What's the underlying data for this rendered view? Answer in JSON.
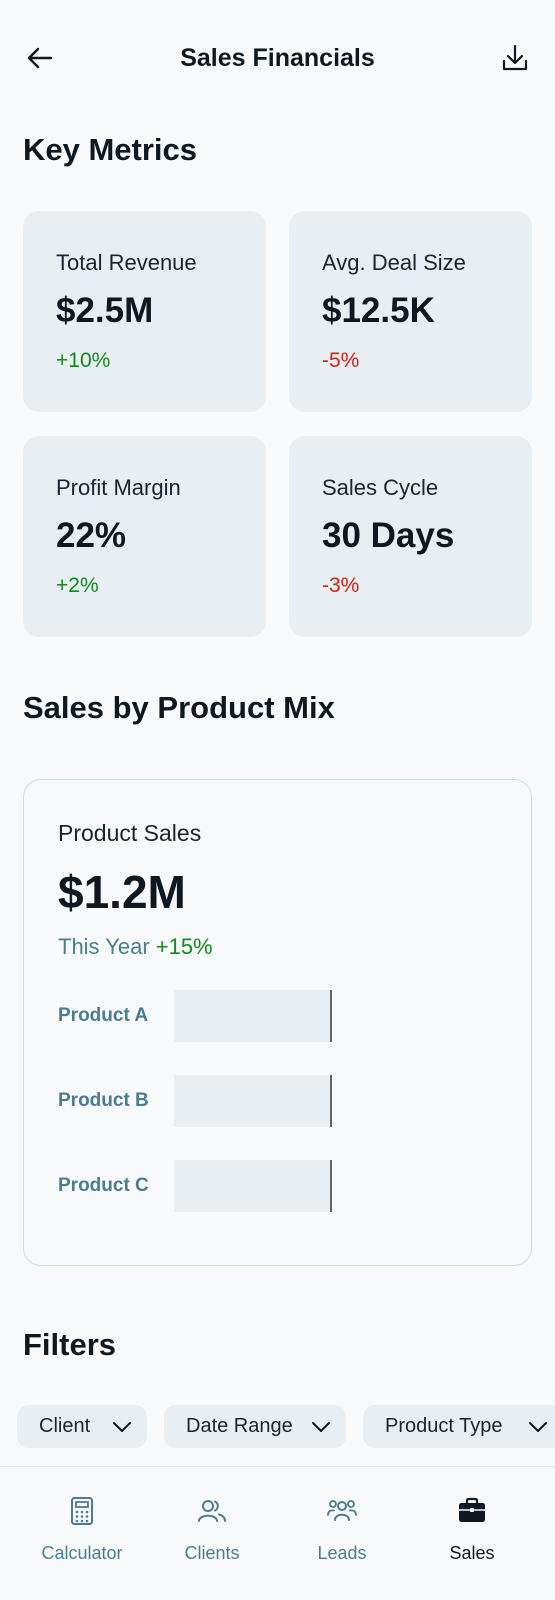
{
  "header": {
    "title": "Sales Financials",
    "back_icon": "arrow-left-icon",
    "download_icon": "download-icon"
  },
  "key_metrics": {
    "title": "Key Metrics",
    "cards": [
      {
        "label": "Total Revenue",
        "value": "$2.5M",
        "change": "+10%",
        "trend": "positive"
      },
      {
        "label": "Avg. Deal Size",
        "value": "$12.5K",
        "change": "-5%",
        "trend": "negative"
      },
      {
        "label": "Profit Margin",
        "value": "22%",
        "change": "+2%",
        "trend": "positive"
      },
      {
        "label": "Sales Cycle",
        "value": "30 Days",
        "change": "-3%",
        "trend": "negative"
      }
    ]
  },
  "product_mix": {
    "title": "Sales by Product Mix",
    "card_title": "Product Sales",
    "total": "$1.2M",
    "period": "This Year",
    "change": "+15%"
  },
  "chart_data": {
    "type": "bar",
    "orientation": "horizontal",
    "categories": [
      "Product A",
      "Product B",
      "Product C"
    ],
    "values": [
      1,
      1,
      1
    ],
    "xlim": [
      0,
      1
    ]
  },
  "filters": {
    "title": "Filters",
    "chips": [
      {
        "label": "Client"
      },
      {
        "label": "Date Range"
      },
      {
        "label": "Product Type"
      }
    ]
  },
  "bottom_nav": {
    "items": [
      {
        "label": "Calculator",
        "icon": "calculator-icon",
        "active": false
      },
      {
        "label": "Clients",
        "icon": "clients-icon",
        "active": false
      },
      {
        "label": "Leads",
        "icon": "leads-icon",
        "active": false
      },
      {
        "label": "Sales",
        "icon": "briefcase-icon",
        "active": true
      }
    ]
  },
  "colors": {
    "background": "#f7f9fb",
    "card": "#e8eef2",
    "positive": "#128a1f",
    "negative": "#d61f0f",
    "muted_teal": "#4a7d92",
    "chart_border": "#c6e3e3"
  }
}
